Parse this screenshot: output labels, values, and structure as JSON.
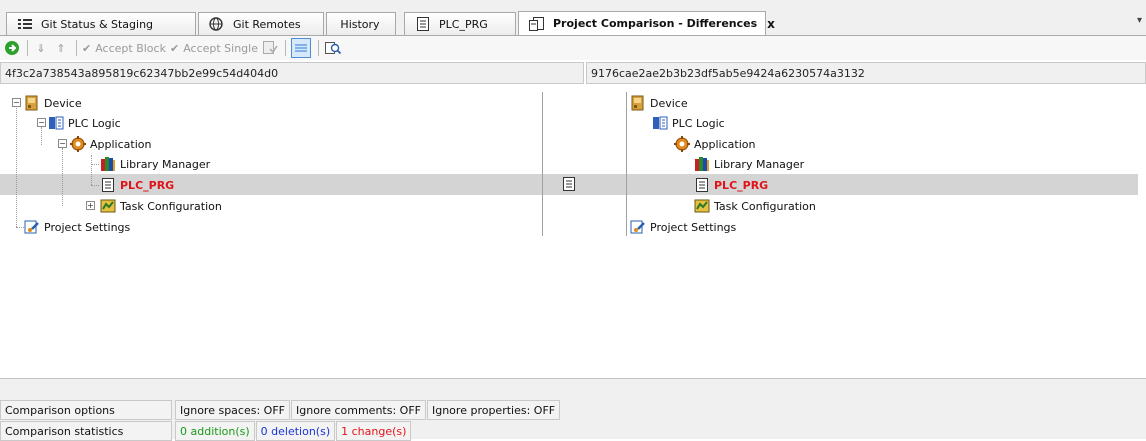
{
  "tabs": [
    {
      "label": "Git Status & Staging",
      "icon": "list-icon"
    },
    {
      "label": "Git Remotes",
      "icon": "globe-icon"
    },
    {
      "label": "History",
      "icon": ""
    },
    {
      "label": "PLC_PRG",
      "icon": "document-icon"
    },
    {
      "label": "Project Comparison - Differences",
      "icon": "compare-document-icon",
      "close": "x"
    }
  ],
  "toolbar": {
    "accept_block": "Accept Block",
    "accept_single": "Accept Single"
  },
  "left_hash": "4f3c2a738543a895819c62347bb2e99c54d404d0",
  "right_hash": "9176cae2ae2b3b23df5ab5e9424a6230574a3132",
  "tree": {
    "device": "Device",
    "plc_logic": "PLC Logic",
    "application": "Application",
    "library_manager": "Library Manager",
    "plc_prg": "PLC_PRG",
    "task_configuration": "Task Configuration",
    "project_settings": "Project Settings"
  },
  "options": {
    "label": "Comparison options",
    "ignore_spaces": "Ignore spaces: OFF",
    "ignore_comments": "Ignore comments: OFF",
    "ignore_properties": "Ignore properties: OFF"
  },
  "statistics": {
    "label": "Comparison statistics",
    "additions": "0 addition(s)",
    "deletions": "0 deletion(s)",
    "changes": "1 change(s)"
  },
  "colors": {
    "changed": "#e0141a",
    "addition": "#1a9a1a",
    "deletion": "#1a36d6",
    "highlight_row": "#d4d4d4"
  }
}
